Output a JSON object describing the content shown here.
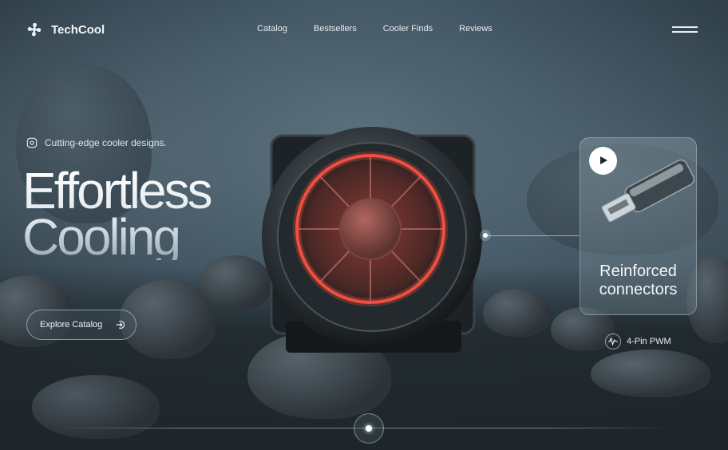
{
  "brand": {
    "name": "TechCool",
    "icon": "fan-logo-icon"
  },
  "nav": {
    "items": [
      "Catalog",
      "Bestsellers",
      "Cooler Finds",
      "Reviews"
    ],
    "menu_icon": "hamburger-menu-icon"
  },
  "hero": {
    "tagline": "Cutting-edge cooler designs.",
    "headline_line1": "Effortless",
    "headline_line2": "Cooling",
    "cta_label": "Explore Catalog",
    "cta_icon": "login-arrow-icon"
  },
  "feature_card": {
    "title_line1": "Reinforced",
    "title_line2": "connectors",
    "play_icon": "play-icon"
  },
  "spec_badge": {
    "label": "4-Pin PWM",
    "icon": "waveform-icon"
  },
  "colors": {
    "accent_glow": "#e8362b",
    "text": "#eef3f6",
    "background": "#3d505d"
  }
}
